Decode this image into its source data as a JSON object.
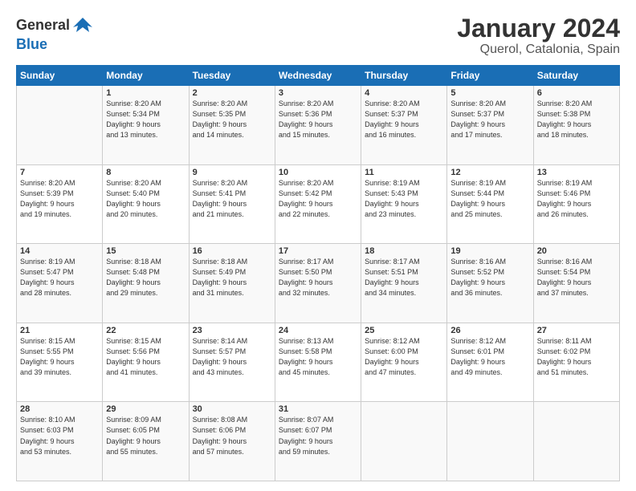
{
  "header": {
    "logo_general": "General",
    "logo_blue": "Blue",
    "title": "January 2024",
    "subtitle": "Querol, Catalonia, Spain"
  },
  "calendar": {
    "days_of_week": [
      "Sunday",
      "Monday",
      "Tuesday",
      "Wednesday",
      "Thursday",
      "Friday",
      "Saturday"
    ],
    "weeks": [
      [
        {
          "num": "",
          "info": ""
        },
        {
          "num": "1",
          "info": "Sunrise: 8:20 AM\nSunset: 5:34 PM\nDaylight: 9 hours\nand 13 minutes."
        },
        {
          "num": "2",
          "info": "Sunrise: 8:20 AM\nSunset: 5:35 PM\nDaylight: 9 hours\nand 14 minutes."
        },
        {
          "num": "3",
          "info": "Sunrise: 8:20 AM\nSunset: 5:36 PM\nDaylight: 9 hours\nand 15 minutes."
        },
        {
          "num": "4",
          "info": "Sunrise: 8:20 AM\nSunset: 5:37 PM\nDaylight: 9 hours\nand 16 minutes."
        },
        {
          "num": "5",
          "info": "Sunrise: 8:20 AM\nSunset: 5:37 PM\nDaylight: 9 hours\nand 17 minutes."
        },
        {
          "num": "6",
          "info": "Sunrise: 8:20 AM\nSunset: 5:38 PM\nDaylight: 9 hours\nand 18 minutes."
        }
      ],
      [
        {
          "num": "7",
          "info": "Sunrise: 8:20 AM\nSunset: 5:39 PM\nDaylight: 9 hours\nand 19 minutes."
        },
        {
          "num": "8",
          "info": "Sunrise: 8:20 AM\nSunset: 5:40 PM\nDaylight: 9 hours\nand 20 minutes."
        },
        {
          "num": "9",
          "info": "Sunrise: 8:20 AM\nSunset: 5:41 PM\nDaylight: 9 hours\nand 21 minutes."
        },
        {
          "num": "10",
          "info": "Sunrise: 8:20 AM\nSunset: 5:42 PM\nDaylight: 9 hours\nand 22 minutes."
        },
        {
          "num": "11",
          "info": "Sunrise: 8:19 AM\nSunset: 5:43 PM\nDaylight: 9 hours\nand 23 minutes."
        },
        {
          "num": "12",
          "info": "Sunrise: 8:19 AM\nSunset: 5:44 PM\nDaylight: 9 hours\nand 25 minutes."
        },
        {
          "num": "13",
          "info": "Sunrise: 8:19 AM\nSunset: 5:46 PM\nDaylight: 9 hours\nand 26 minutes."
        }
      ],
      [
        {
          "num": "14",
          "info": "Sunrise: 8:19 AM\nSunset: 5:47 PM\nDaylight: 9 hours\nand 28 minutes."
        },
        {
          "num": "15",
          "info": "Sunrise: 8:18 AM\nSunset: 5:48 PM\nDaylight: 9 hours\nand 29 minutes."
        },
        {
          "num": "16",
          "info": "Sunrise: 8:18 AM\nSunset: 5:49 PM\nDaylight: 9 hours\nand 31 minutes."
        },
        {
          "num": "17",
          "info": "Sunrise: 8:17 AM\nSunset: 5:50 PM\nDaylight: 9 hours\nand 32 minutes."
        },
        {
          "num": "18",
          "info": "Sunrise: 8:17 AM\nSunset: 5:51 PM\nDaylight: 9 hours\nand 34 minutes."
        },
        {
          "num": "19",
          "info": "Sunrise: 8:16 AM\nSunset: 5:52 PM\nDaylight: 9 hours\nand 36 minutes."
        },
        {
          "num": "20",
          "info": "Sunrise: 8:16 AM\nSunset: 5:54 PM\nDaylight: 9 hours\nand 37 minutes."
        }
      ],
      [
        {
          "num": "21",
          "info": "Sunrise: 8:15 AM\nSunset: 5:55 PM\nDaylight: 9 hours\nand 39 minutes."
        },
        {
          "num": "22",
          "info": "Sunrise: 8:15 AM\nSunset: 5:56 PM\nDaylight: 9 hours\nand 41 minutes."
        },
        {
          "num": "23",
          "info": "Sunrise: 8:14 AM\nSunset: 5:57 PM\nDaylight: 9 hours\nand 43 minutes."
        },
        {
          "num": "24",
          "info": "Sunrise: 8:13 AM\nSunset: 5:58 PM\nDaylight: 9 hours\nand 45 minutes."
        },
        {
          "num": "25",
          "info": "Sunrise: 8:12 AM\nSunset: 6:00 PM\nDaylight: 9 hours\nand 47 minutes."
        },
        {
          "num": "26",
          "info": "Sunrise: 8:12 AM\nSunset: 6:01 PM\nDaylight: 9 hours\nand 49 minutes."
        },
        {
          "num": "27",
          "info": "Sunrise: 8:11 AM\nSunset: 6:02 PM\nDaylight: 9 hours\nand 51 minutes."
        }
      ],
      [
        {
          "num": "28",
          "info": "Sunrise: 8:10 AM\nSunset: 6:03 PM\nDaylight: 9 hours\nand 53 minutes."
        },
        {
          "num": "29",
          "info": "Sunrise: 8:09 AM\nSunset: 6:05 PM\nDaylight: 9 hours\nand 55 minutes."
        },
        {
          "num": "30",
          "info": "Sunrise: 8:08 AM\nSunset: 6:06 PM\nDaylight: 9 hours\nand 57 minutes."
        },
        {
          "num": "31",
          "info": "Sunrise: 8:07 AM\nSunset: 6:07 PM\nDaylight: 9 hours\nand 59 minutes."
        },
        {
          "num": "",
          "info": ""
        },
        {
          "num": "",
          "info": ""
        },
        {
          "num": "",
          "info": ""
        }
      ]
    ]
  }
}
